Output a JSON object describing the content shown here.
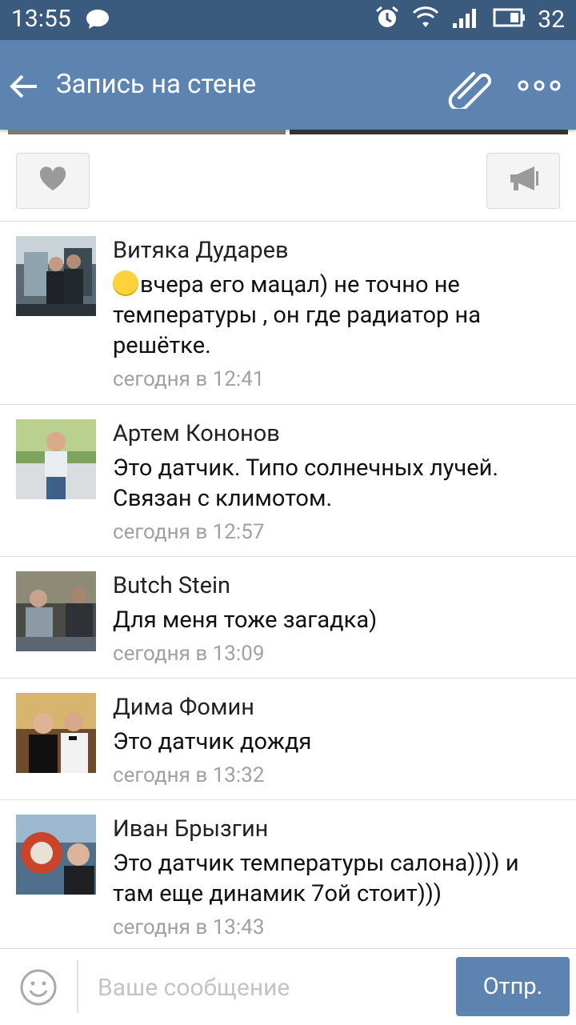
{
  "status_bar": {
    "time": "13:55",
    "battery": "32"
  },
  "toolbar": {
    "title": "Запись на стене"
  },
  "comments": [
    {
      "name": "Витяка Дударев",
      "text": "вчера его мацал) не точно не температуры , он где радиатор на решётке.",
      "time": "сегодня в 12:41",
      "emoji": "smile-emoji"
    },
    {
      "name": "Артем Кононов",
      "text": "Это датчик. Типо солнечных лучей. Связан с климотом.",
      "time": "сегодня в 12:57"
    },
    {
      "name": "Butch Stein",
      "text": "Для меня тоже загадка)",
      "time": "сегодня в 13:09"
    },
    {
      "name": "Дима Фомин",
      "text": "Это датчик дождя",
      "time": "сегодня в 13:32"
    },
    {
      "name": "Иван Брызгин",
      "text": "Это датчик температуры салона)))) и там еще динамик 7ой стоит)))",
      "time": "сегодня в 13:43"
    }
  ],
  "composer": {
    "placeholder": "Ваше сообщение",
    "send_label": "Отпр."
  },
  "colors": {
    "accent": "#5d83b1",
    "status_bar": "#3a5a7e"
  }
}
